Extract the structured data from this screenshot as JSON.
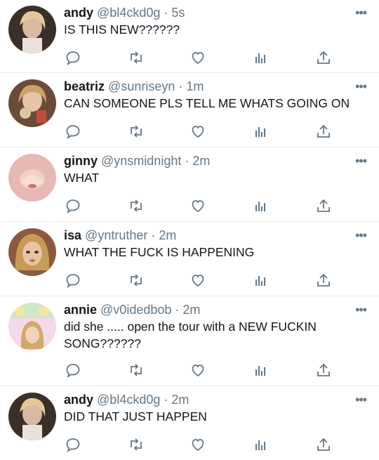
{
  "colors": {
    "text": "#14171a",
    "muted": "#657786",
    "divider": "#e6ecf0"
  },
  "tweets": [
    {
      "name": "andy",
      "handle": "@bl4ckd0g",
      "dot": "·",
      "time": "5s",
      "text": "IS THIS NEW??????",
      "avatar_icon": "avatar-andy"
    },
    {
      "name": "beatriz",
      "handle": "@sunriseyn",
      "dot": "·",
      "time": "1m",
      "text": "CAN SOMEONE PLS TELL ME WHATS GOING ON",
      "avatar_icon": "avatar-beatriz"
    },
    {
      "name": "ginny",
      "handle": "@ynsmidnight",
      "dot": "·",
      "time": "2m",
      "text": "WHAT",
      "avatar_icon": "avatar-ginny"
    },
    {
      "name": "isa",
      "handle": "@yntruther",
      "dot": "·",
      "time": "2m",
      "text": "WHAT THE FUCK IS HAPPENING",
      "avatar_icon": "avatar-isa"
    },
    {
      "name": "annie",
      "handle": "@v0idedbob",
      "dot": "·",
      "time": "2m",
      "text": "did she ..... open the tour with a NEW FUCKIN SONG??????",
      "avatar_icon": "avatar-annie"
    },
    {
      "name": "andy",
      "handle": "@bl4ckd0g",
      "dot": "·",
      "time": "2m",
      "text": "DID THAT JUST HAPPEN",
      "avatar_icon": "avatar-andy"
    }
  ],
  "action_icons": [
    "reply-icon",
    "retweet-icon",
    "like-icon",
    "analytics-icon",
    "share-icon"
  ],
  "more_label": "•••"
}
